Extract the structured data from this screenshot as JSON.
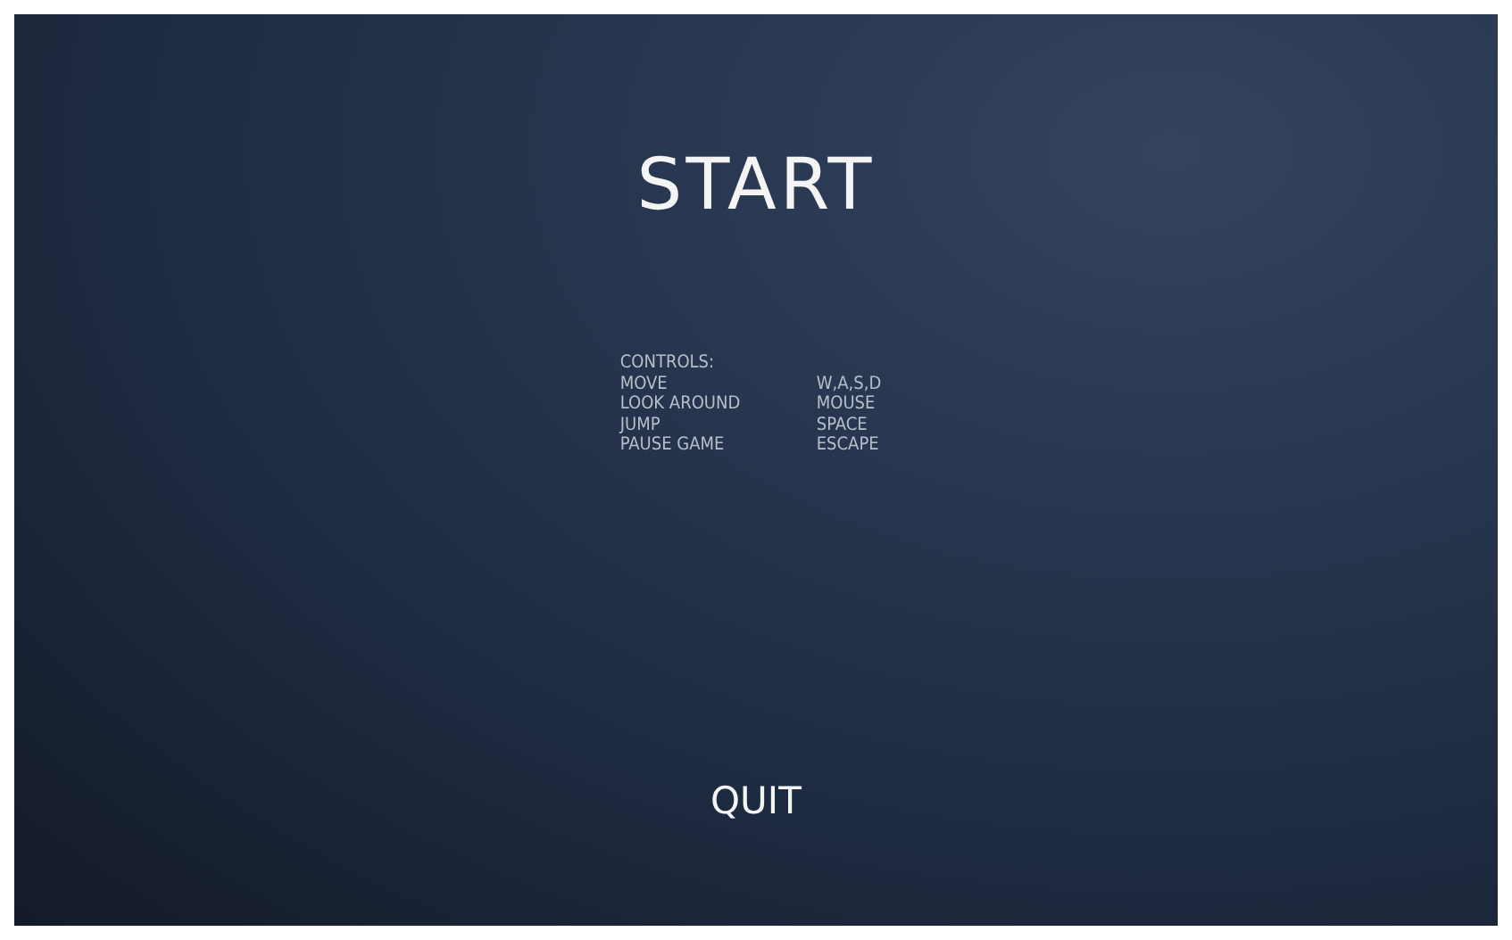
{
  "start_button": "START",
  "controls": {
    "heading": "CONTROLS:",
    "rows": [
      {
        "action": "MOVE",
        "key": "W,A,S,D"
      },
      {
        "action": "LOOK AROUND",
        "key": "MOUSE"
      },
      {
        "action": "JUMP",
        "key": "SPACE"
      },
      {
        "action": "PAUSE GAME",
        "key": "ESCAPE"
      }
    ]
  },
  "quit_button": "QUIT"
}
